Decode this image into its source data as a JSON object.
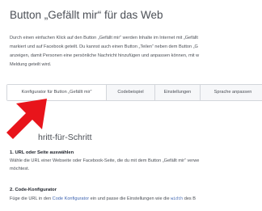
{
  "header": {
    "title": "Button „Gefällt mir“ für das Web"
  },
  "intro": {
    "lines": [
      "Durch einen einfachen Klick auf den Button „Gefällt mir“ werden Inhalte im Internet mit „Gefällt",
      "markiert und auf Facebook geteilt. Du kannst auch einen Button „Teilen“ neben dem Button „G",
      "anzeigen, damit Personen eine persönliche Nachricht hinzufügen und anpassen können, mit w",
      "Meldung geteilt wird."
    ]
  },
  "tabs": [
    {
      "label": "Konfigurator für Button „Gefällt mir“"
    },
    {
      "label": "Codebeispiel"
    },
    {
      "label": "Einstellungen"
    },
    {
      "label": "Sprache anpassen"
    }
  ],
  "section": {
    "heading": "hritt-für-Schritt"
  },
  "steps": [
    {
      "title": "1. URL oder Seite auswählen",
      "line1": "Wähle die URL einer Webseite oder Facebook-Seite, die du mit dem Button „Gefällt mir“ verwe",
      "line2": "möchtest."
    },
    {
      "title": "2. Code-Konfigurator",
      "pre": "Füge die URL in den ",
      "link": "Code Konfigurator",
      "mid": " ein und passe die Einstellungen wie die ",
      "code": "width",
      "post": " des B"
    }
  ],
  "colors": {
    "accent": "#4267b2",
    "arrow": "#e8141b",
    "text": "#4b4f56"
  },
  "icons": {
    "arrow": "red-pointer-arrow"
  }
}
